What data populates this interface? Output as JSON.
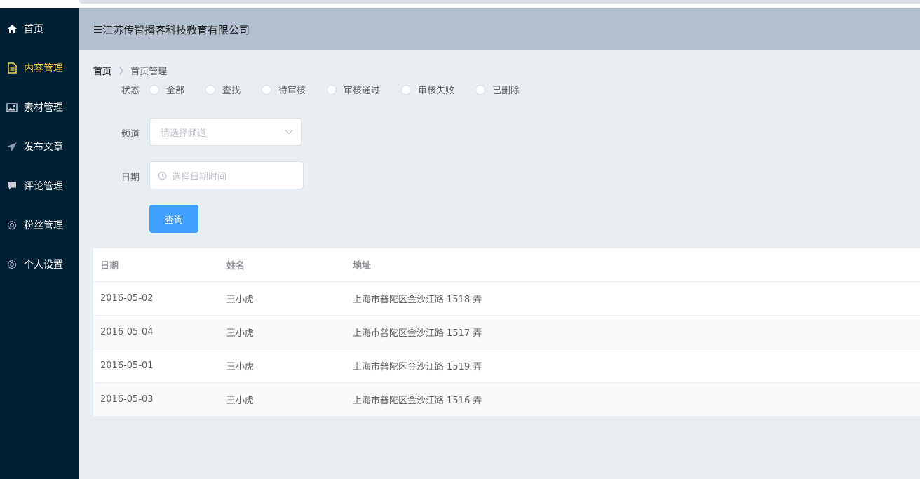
{
  "header": {
    "title": "江苏传智播客科技教育有限公司",
    "toggle_icon": "menu-fold-icon"
  },
  "sidebar": {
    "items": [
      {
        "label": "首页",
        "icon": "home-icon",
        "active": false
      },
      {
        "label": "内容管理",
        "icon": "document-icon",
        "active": true
      },
      {
        "label": "素材管理",
        "icon": "picture-icon",
        "active": false
      },
      {
        "label": "发布文章",
        "icon": "send-icon",
        "active": false
      },
      {
        "label": "评论管理",
        "icon": "comment-icon",
        "active": false
      },
      {
        "label": "粉丝管理",
        "icon": "gear-icon",
        "active": false
      },
      {
        "label": "个人设置",
        "icon": "gear-icon",
        "active": false
      }
    ],
    "active_color": "#ffd04b",
    "bg_color": "#002033"
  },
  "breadcrumb": {
    "home": "首页",
    "current": "首页管理"
  },
  "filter": {
    "status_label": "状态",
    "status_options": [
      "全部",
      "查找",
      "待审核",
      "审核通过",
      "审核失败",
      "已删除"
    ],
    "channel_label": "频道",
    "channel_placeholder": "请选择频道",
    "date_label": "日期",
    "date_placeholder": "选择日期时间",
    "query_button": "查询"
  },
  "table": {
    "columns": [
      "日期",
      "姓名",
      "地址"
    ],
    "rows": [
      [
        "2016-05-02",
        "王小虎",
        "上海市普陀区金沙江路 1518 弄"
      ],
      [
        "2016-05-04",
        "王小虎",
        "上海市普陀区金沙江路 1517 弄"
      ],
      [
        "2016-05-01",
        "王小虎",
        "上海市普陀区金沙江路 1519 弄"
      ],
      [
        "2016-05-03",
        "王小虎",
        "上海市普陀区金沙江路 1516 弄"
      ]
    ]
  },
  "colors": {
    "primary": "#409eff",
    "header_bg": "#b3c0d1",
    "main_bg": "#e9eef3"
  }
}
